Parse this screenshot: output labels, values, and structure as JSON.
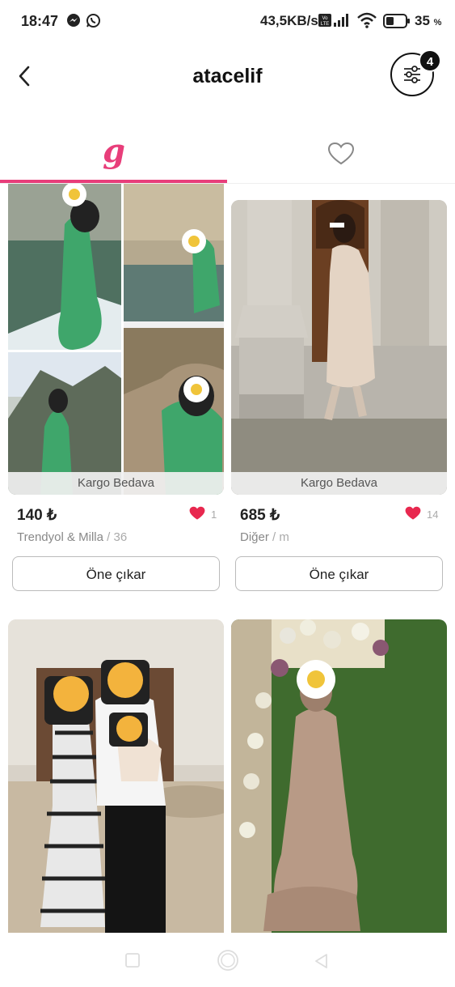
{
  "status_bar": {
    "time": "18:47",
    "network_speed": "43,5KB/s",
    "battery_level": "35",
    "battery_unit": "%",
    "icons": [
      "messenger-icon",
      "whatsapp-icon",
      "volte-icon",
      "signal-icon",
      "wifi-icon",
      "battery-icon"
    ]
  },
  "header": {
    "title": "atacelif",
    "filter_count": "4",
    "icons": [
      "back-arrow-icon",
      "filter-sliders-icon"
    ]
  },
  "tabs": [
    {
      "name": "closet",
      "icon": "g-logo-icon",
      "glyph": "g",
      "active": true
    },
    {
      "name": "likes",
      "icon": "heart-outline-icon",
      "active": false
    }
  ],
  "accent_color": "#e83e7a",
  "heart_color": "#e8284f",
  "products": [
    {
      "shipping": "Kargo Bedava",
      "price": "140 ₺",
      "likes": "1",
      "brand": "Trendyol & Milla",
      "separator": "/",
      "size": "36",
      "action": "Öne çıkar"
    },
    {
      "shipping": "Kargo Bedava",
      "price": "685 ₺",
      "likes": "14",
      "brand": "Diğer",
      "separator": "/",
      "size": "m",
      "action": "Öne çıkar"
    },
    {},
    {}
  ],
  "nav_bar": {
    "icons": [
      "recents-square-icon",
      "home-circle-icon",
      "back-triangle-icon"
    ]
  }
}
